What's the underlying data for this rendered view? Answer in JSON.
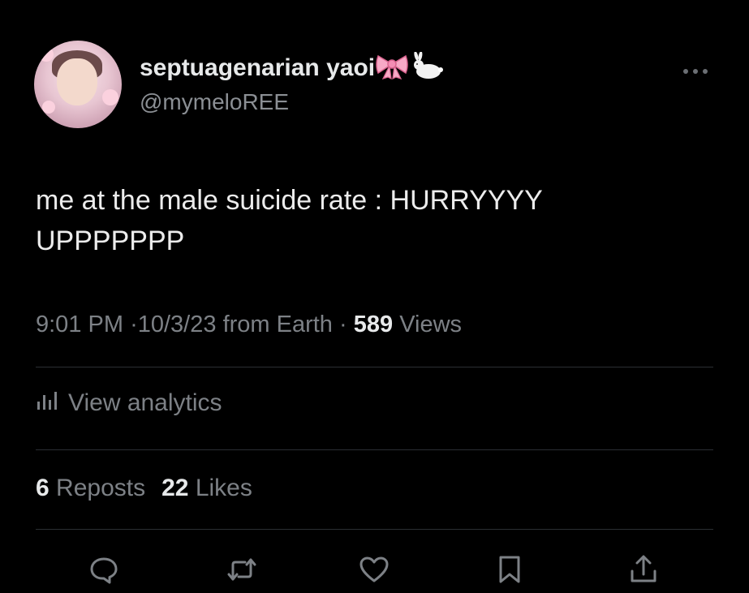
{
  "user": {
    "display_name": "septuagenarian yaoi",
    "handle": "@mymeloREE"
  },
  "tweet": {
    "text": "me at the male suicide rate : HURRYYYY\nUPPPPPPP"
  },
  "meta": {
    "time": "9:01 PM",
    "date": "10/3/23",
    "from": "from Earth",
    "separator": "·",
    "views_count": "589",
    "views_label": "Views"
  },
  "analytics": {
    "label": "View analytics"
  },
  "stats": {
    "reposts_count": "6",
    "reposts_label": "Reposts",
    "likes_count": "22",
    "likes_label": "Likes"
  },
  "icons": {
    "more": "more-dots-icon",
    "reply": "reply-icon",
    "repost": "repost-icon",
    "like": "heart-icon",
    "bookmark": "bookmark-icon",
    "share": "share-icon",
    "analytics": "bar-chart-icon",
    "bow": "pink-bow-icon",
    "rabbit": "rabbit-icon"
  },
  "colors": {
    "background": "#000000",
    "primary_text": "#e7e9ea",
    "secondary_text": "#7d8186",
    "divider": "#2b2e33"
  }
}
